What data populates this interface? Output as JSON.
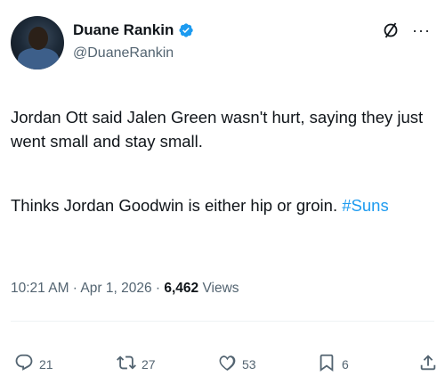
{
  "author": {
    "display_name": "Duane Rankin",
    "handle": "@DuaneRankin",
    "verified": true
  },
  "tweet": {
    "paragraph1": "Jordan Ott said Jalen Green wasn't hurt, saying they just went small and stay small.",
    "paragraph2_text": "Thinks Jordan Goodwin is either hip or groin. ",
    "hashtag": "#Suns"
  },
  "meta": {
    "time": "10:21 AM",
    "separator1": " · ",
    "date": "Apr 1, 2026",
    "separator2": " · ",
    "views_count": "6,462",
    "views_label": " Views"
  },
  "actions": {
    "replies": "21",
    "reposts": "27",
    "likes": "53",
    "bookmarks": "6"
  },
  "icons": {
    "verified": "verified-badge-icon",
    "grok": "slash-circle-icon",
    "more": "more-icon",
    "reply": "reply-icon",
    "repost": "repost-icon",
    "like": "heart-icon",
    "bookmark": "bookmark-icon",
    "share": "share-icon"
  },
  "colors": {
    "accent": "#1d9bf0",
    "text": "#0f1419",
    "secondary": "#536471"
  }
}
